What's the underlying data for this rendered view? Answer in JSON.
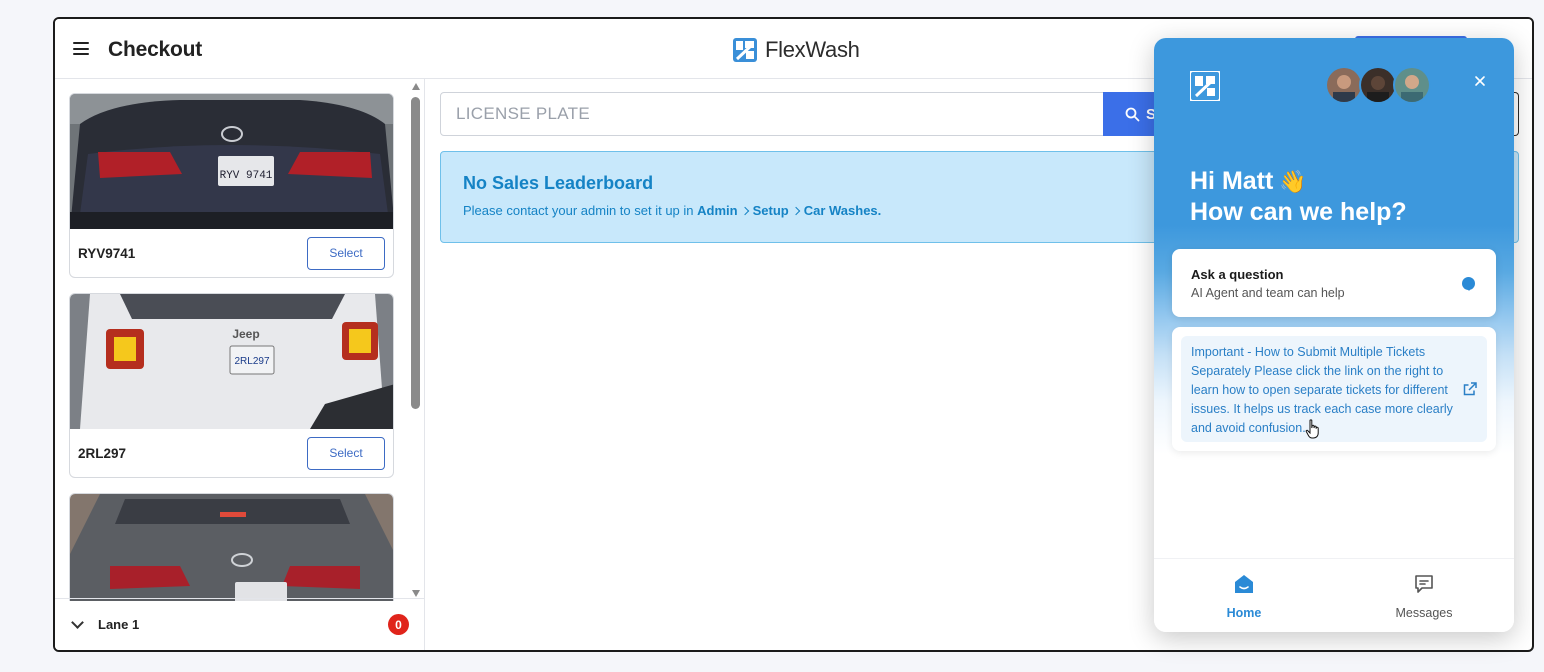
{
  "header": {
    "title": "Checkout",
    "brand": "FlexWash"
  },
  "vehicles": [
    {
      "plate": "RYV9741",
      "select_label": "Select"
    },
    {
      "plate": "2RL297",
      "select_label": "Select"
    },
    {
      "plate": "",
      "select_label": ""
    }
  ],
  "lane": {
    "label": "Lane 1",
    "count": "0"
  },
  "search": {
    "placeholder": "LICENSE PLATE",
    "button_label": "S"
  },
  "alert": {
    "title": "No Sales Leaderboard",
    "text": "Please contact your admin to set it up in",
    "path": [
      "Admin",
      "Setup",
      "Car Washes."
    ]
  },
  "messenger": {
    "greeting_line1": "Hi Matt",
    "wave": "👋",
    "greeting_line2": "How can we help?",
    "ask_title": "Ask a question",
    "ask_subtitle": "AI Agent and team can help",
    "notice": "Important - How to Submit Multiple Tickets Separately Please click the link on the right to learn how to open separate tickets for different issues. It helps us track each case more clearly and avoid confusion.",
    "nav": {
      "home": "Home",
      "messages": "Messages"
    }
  },
  "colors": {
    "primary_blue": "#3b6fe8",
    "messenger_blue": "#3d98dd",
    "alert_bg": "#c8e8fb",
    "alert_text": "#1583c5",
    "badge_red": "#e0241b"
  },
  "icons": [
    "menu-icon",
    "flexwash-logo",
    "search-icon",
    "close-icon",
    "help-icon",
    "external-link-icon",
    "home-icon",
    "messages-icon",
    "chevron-down-icon"
  ]
}
